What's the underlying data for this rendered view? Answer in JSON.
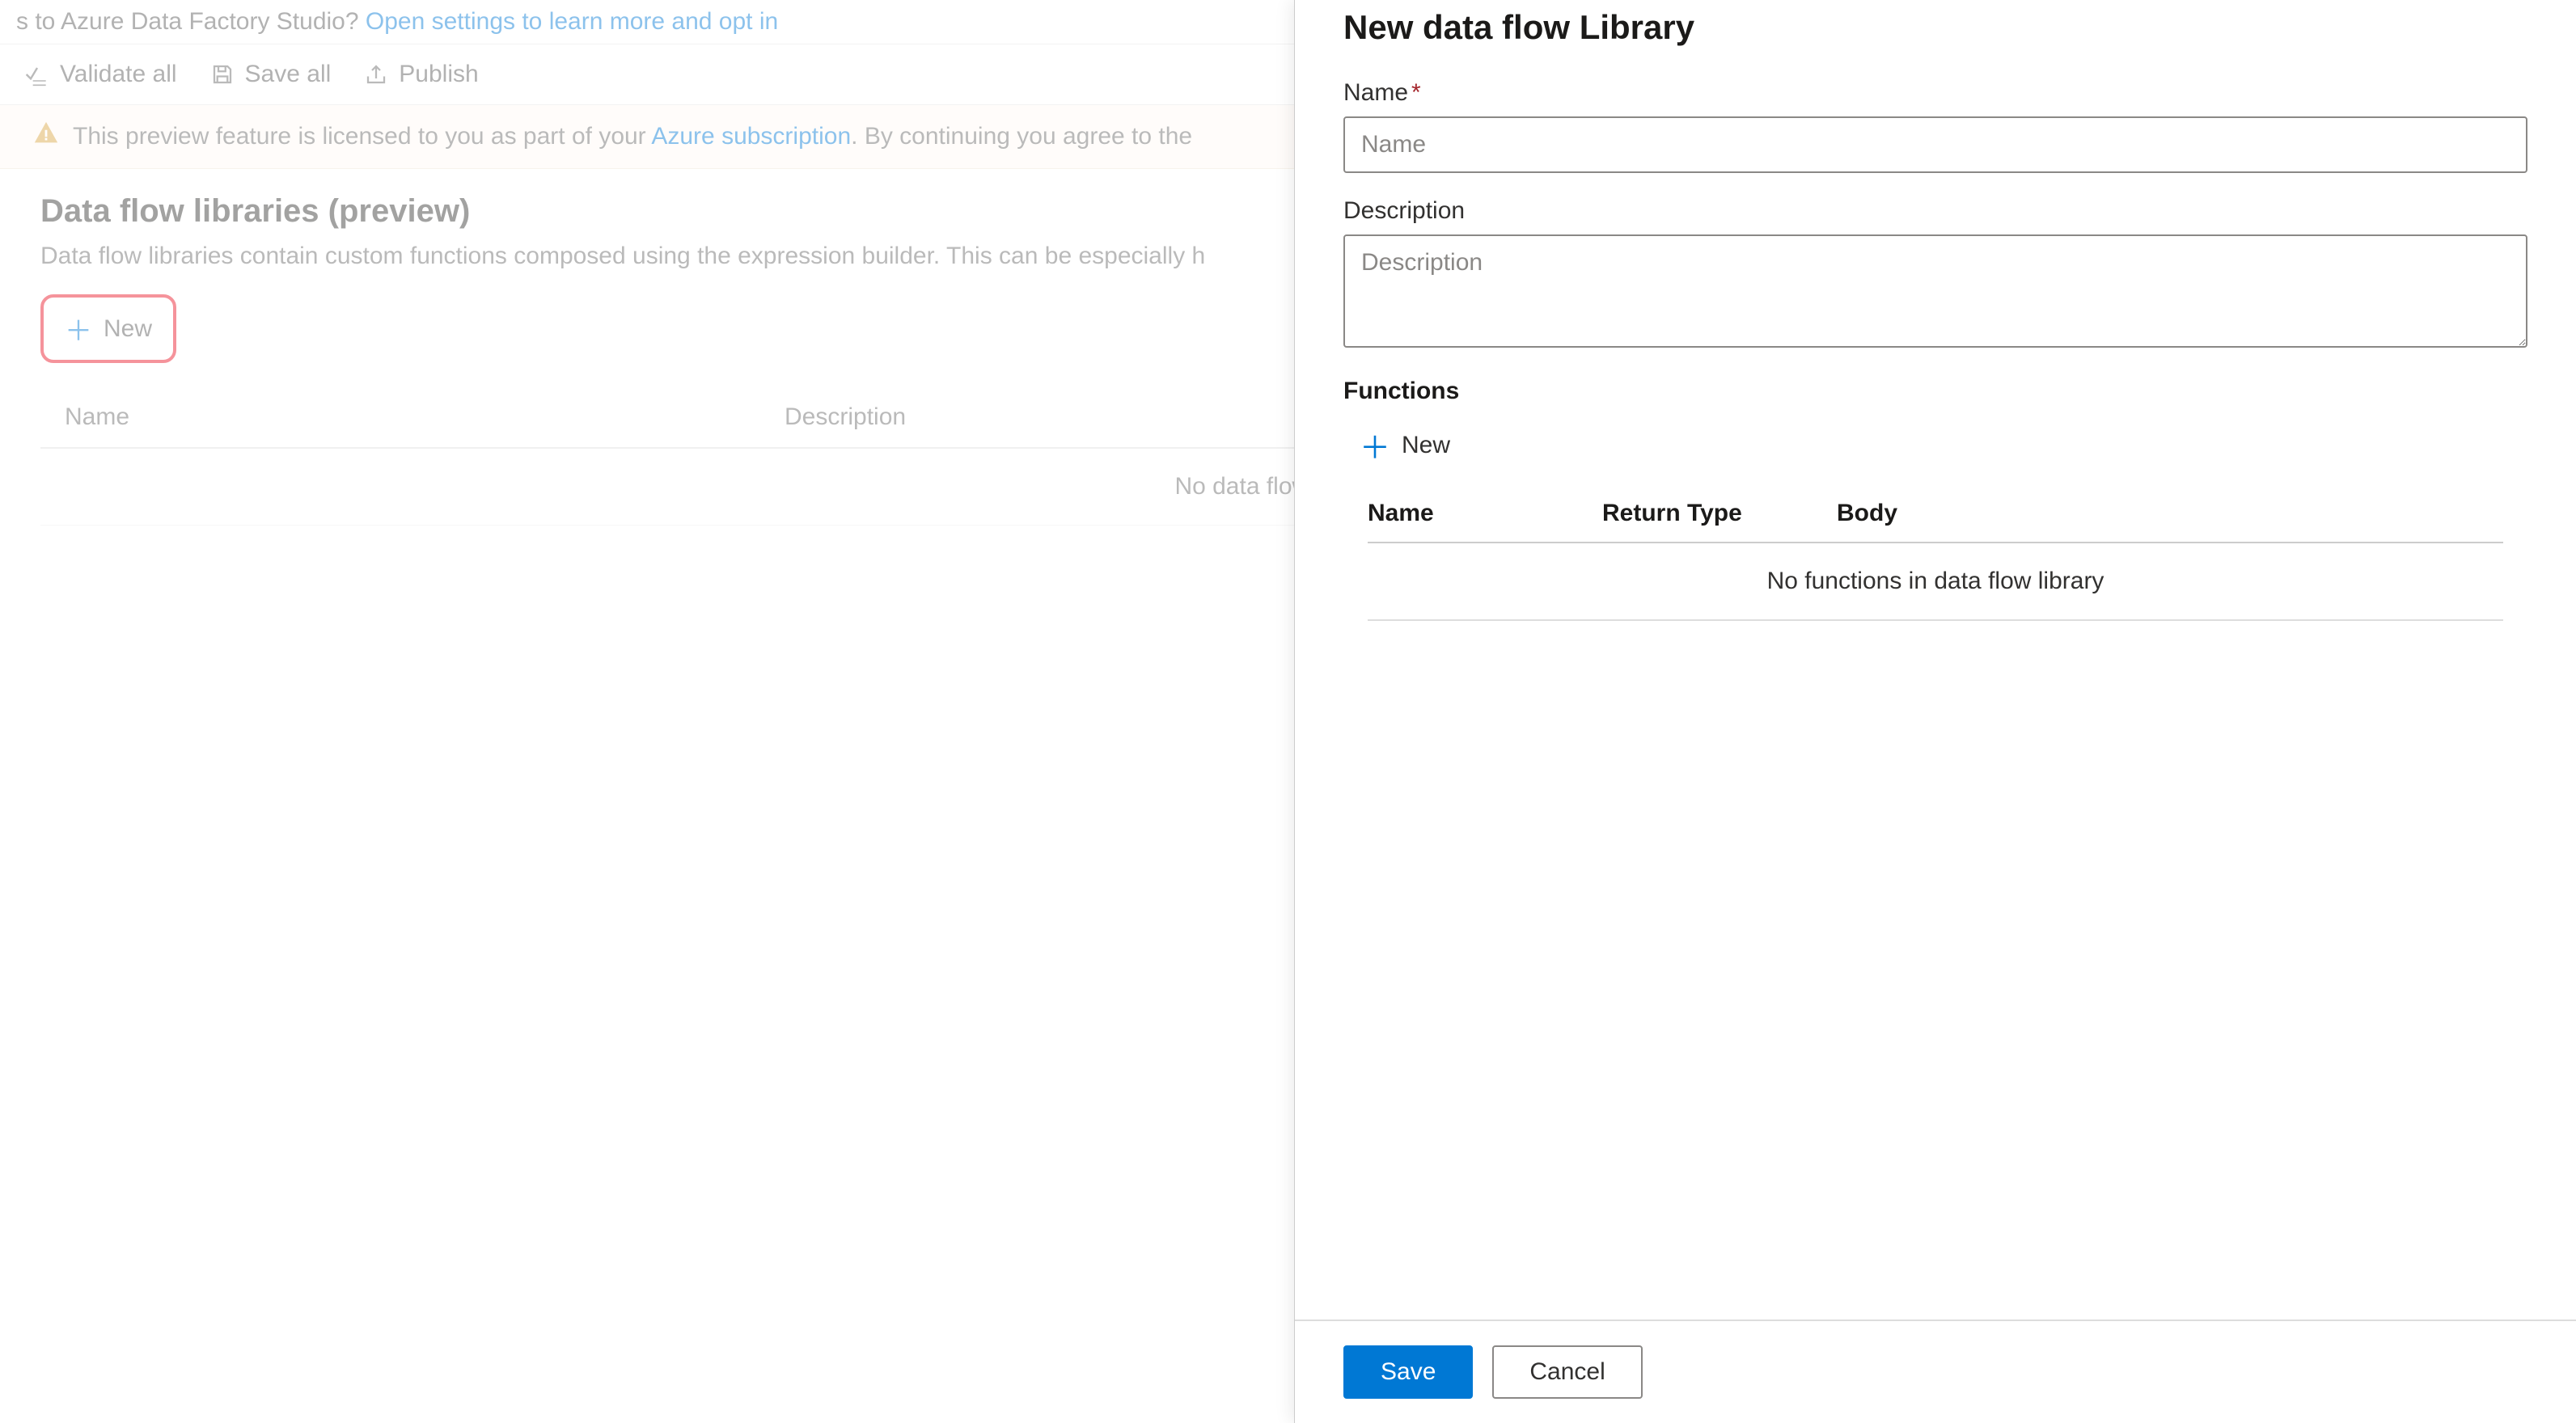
{
  "top_banner": {
    "text_prefix": "s to Azure Data Factory Studio? ",
    "link_text": "Open settings to learn more and opt in"
  },
  "toolbar": {
    "validate_all": "Validate all",
    "save_all": "Save all",
    "publish": "Publish"
  },
  "preview_notice": {
    "prefix": "This preview feature is licensed to you as part of your ",
    "link": "Azure subscription",
    "suffix": ". By continuing you agree to the"
  },
  "main": {
    "title": "Data flow libraries (preview)",
    "subtitle": "Data flow libraries contain custom functions composed using the expression builder. This can be especially h",
    "new_button": "New",
    "table": {
      "col_name": "Name",
      "col_description": "Description",
      "empty_message": "No data flow libraries"
    }
  },
  "panel": {
    "title": "New data flow Library",
    "name_label": "Name",
    "name_placeholder": "Name",
    "description_label": "Description",
    "description_placeholder": "Description",
    "functions_label": "Functions",
    "add_function": "New",
    "functions_table": {
      "col_name": "Name",
      "col_return": "Return Type",
      "col_body": "Body",
      "empty_message": "No functions in data flow library"
    },
    "save": "Save",
    "cancel": "Cancel"
  }
}
